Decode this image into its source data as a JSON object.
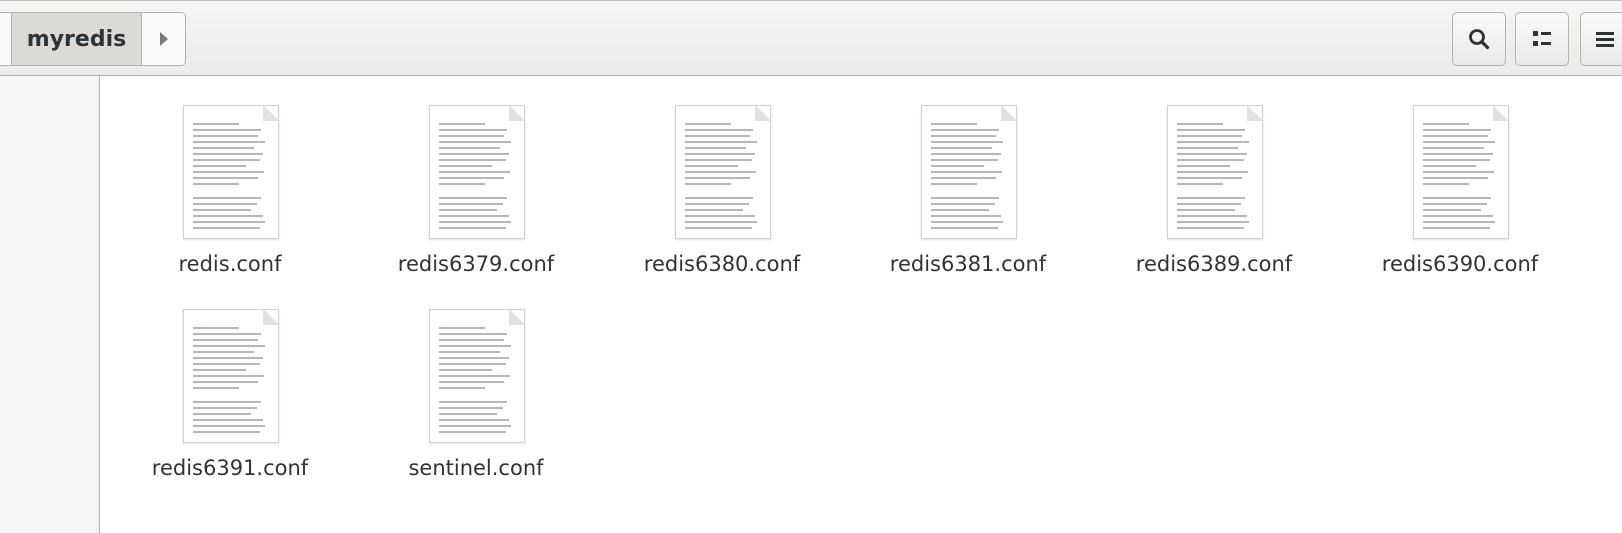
{
  "header": {
    "path_current": "myredis",
    "icons": {
      "search": "search-icon",
      "view": "list-view-icon",
      "menu": "hamburger-menu-icon",
      "next": "arrow-right-icon"
    }
  },
  "files": [
    {
      "name": "redis.conf",
      "icon": "text-file-icon"
    },
    {
      "name": "redis6379.conf",
      "icon": "text-file-icon"
    },
    {
      "name": "redis6380.conf",
      "icon": "text-file-icon"
    },
    {
      "name": "redis6381.conf",
      "icon": "text-file-icon"
    },
    {
      "name": "redis6389.conf",
      "icon": "text-file-icon"
    },
    {
      "name": "redis6390.conf",
      "icon": "text-file-icon"
    },
    {
      "name": "redis6391.conf",
      "icon": "text-file-icon"
    },
    {
      "name": "sentinel.conf",
      "icon": "text-file-icon"
    }
  ]
}
